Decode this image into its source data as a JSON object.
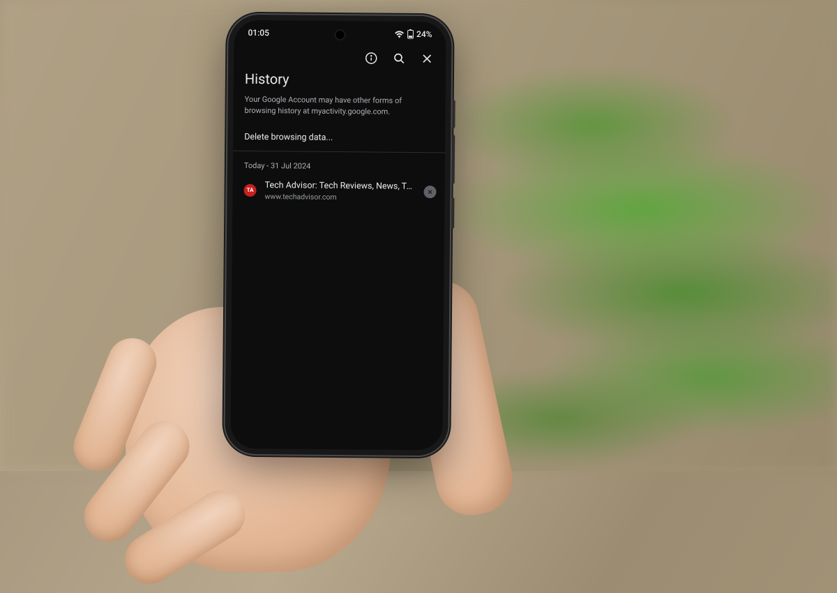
{
  "status_bar": {
    "time": "01:05",
    "battery_pct": "24%"
  },
  "header": {
    "title": "History"
  },
  "subtext": "Your Google Account may have other forms of browsing history at myactivity.google.com.",
  "delete_label": "Delete browsing data...",
  "history": {
    "date_label": "Today - 31 Jul 2024",
    "items": [
      {
        "title": "Tech Advisor: Tech Reviews, News, Tu...",
        "url": "www.techadvisor.com",
        "favicon_text": "TA"
      }
    ]
  }
}
